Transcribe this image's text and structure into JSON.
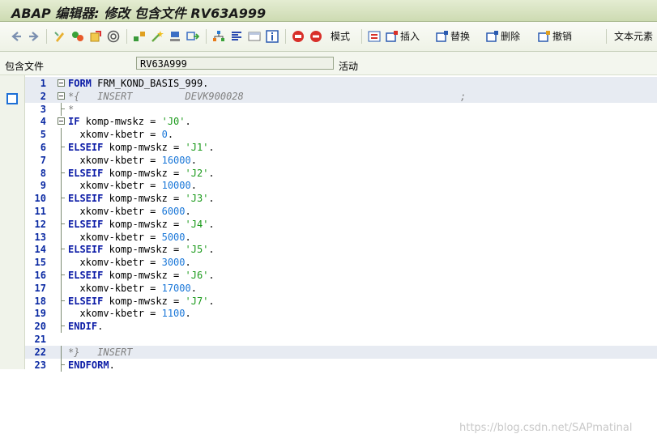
{
  "window": {
    "title": "ABAP 编辑器: 修改 包含文件 RV63A999"
  },
  "toolbar": {
    "icons": [
      "back-arrow-icon",
      "forward-arrow-icon",
      "display-change-icon",
      "other-object-icon",
      "activate-icon",
      "check-icon",
      "where-used-icon",
      "wand-icon",
      "network-icon",
      "window-icon",
      "hierarchy-icon",
      "pretty-printer-icon",
      "layout-icon",
      "info-icon",
      "help-icon",
      "bulletin-icon"
    ],
    "pattern_label": "模式",
    "insert_label": "插入",
    "replace_label": "替换",
    "delete_label": "删除",
    "undo_label": "撤销",
    "text_elements_label": "文本元素"
  },
  "field": {
    "label": "包含文件",
    "value": "RV63A999",
    "status": "活动"
  },
  "editor": {
    "lines": [
      {
        "n": "1",
        "tokens": [
          [
            "kw",
            "FORM"
          ],
          [
            "plain",
            " FRM_KOND_BASIS_999."
          ]
        ],
        "hl": true
      },
      {
        "n": "2",
        "tokens": [
          [
            "cm",
            "*{   INSERT         DEVK900028                                     ;"
          ]
        ],
        "hl": true
      },
      {
        "n": "3",
        "tokens": [
          [
            "cm",
            "*"
          ]
        ],
        "hl": false
      },
      {
        "n": "4",
        "tokens": [
          [
            "kw",
            "IF"
          ],
          [
            "id",
            " komp-mwskz = "
          ],
          [
            "str",
            "'J0'"
          ],
          [
            "id",
            "."
          ]
        ],
        "hl": false
      },
      {
        "n": "5",
        "tokens": [
          [
            "id",
            "  xkomv-kbetr = "
          ],
          [
            "num",
            "0"
          ],
          [
            "id",
            "."
          ]
        ],
        "hl": false
      },
      {
        "n": "6",
        "tokens": [
          [
            "kw",
            "ELSEIF"
          ],
          [
            "id",
            " komp-mwskz = "
          ],
          [
            "str",
            "'J1'"
          ],
          [
            "id",
            "."
          ]
        ],
        "hl": false
      },
      {
        "n": "7",
        "tokens": [
          [
            "id",
            "  xkomv-kbetr = "
          ],
          [
            "num",
            "16000"
          ],
          [
            "id",
            "."
          ]
        ],
        "hl": false
      },
      {
        "n": "8",
        "tokens": [
          [
            "kw",
            "ELSEIF"
          ],
          [
            "id",
            " komp-mwskz = "
          ],
          [
            "str",
            "'J2'"
          ],
          [
            "id",
            "."
          ]
        ],
        "hl": false
      },
      {
        "n": "9",
        "tokens": [
          [
            "id",
            "  xkomv-kbetr = "
          ],
          [
            "num",
            "10000"
          ],
          [
            "id",
            "."
          ]
        ],
        "hl": false
      },
      {
        "n": "10",
        "tokens": [
          [
            "kw",
            "ELSEIF"
          ],
          [
            "id",
            " komp-mwskz = "
          ],
          [
            "str",
            "'J3'"
          ],
          [
            "id",
            "."
          ]
        ],
        "hl": false
      },
      {
        "n": "11",
        "tokens": [
          [
            "id",
            "  xkomv-kbetr = "
          ],
          [
            "num",
            "6000"
          ],
          [
            "id",
            "."
          ]
        ],
        "hl": false
      },
      {
        "n": "12",
        "tokens": [
          [
            "kw",
            "ELSEIF"
          ],
          [
            "id",
            " komp-mwskz = "
          ],
          [
            "str",
            "'J4'"
          ],
          [
            "id",
            "."
          ]
        ],
        "hl": false
      },
      {
        "n": "13",
        "tokens": [
          [
            "id",
            "  xkomv-kbetr = "
          ],
          [
            "num",
            "5000"
          ],
          [
            "id",
            "."
          ]
        ],
        "hl": false
      },
      {
        "n": "14",
        "tokens": [
          [
            "kw",
            "ELSEIF"
          ],
          [
            "id",
            " komp-mwskz = "
          ],
          [
            "str",
            "'J5'"
          ],
          [
            "id",
            "."
          ]
        ],
        "hl": false
      },
      {
        "n": "15",
        "tokens": [
          [
            "id",
            "  xkomv-kbetr = "
          ],
          [
            "num",
            "3000"
          ],
          [
            "id",
            "."
          ]
        ],
        "hl": false
      },
      {
        "n": "16",
        "tokens": [
          [
            "kw",
            "ELSEIF"
          ],
          [
            "id",
            " komp-mwskz = "
          ],
          [
            "str",
            "'J6'"
          ],
          [
            "id",
            "."
          ]
        ],
        "hl": false
      },
      {
        "n": "17",
        "tokens": [
          [
            "id",
            "  xkomv-kbetr = "
          ],
          [
            "num",
            "17000"
          ],
          [
            "id",
            "."
          ]
        ],
        "hl": false
      },
      {
        "n": "18",
        "tokens": [
          [
            "kw",
            "ELSEIF"
          ],
          [
            "id",
            " komp-mwskz = "
          ],
          [
            "str",
            "'J7'"
          ],
          [
            "id",
            "."
          ]
        ],
        "hl": false
      },
      {
        "n": "19",
        "tokens": [
          [
            "id",
            "  xkomv-kbetr = "
          ],
          [
            "num",
            "1100"
          ],
          [
            "id",
            "."
          ]
        ],
        "hl": false
      },
      {
        "n": "20",
        "tokens": [
          [
            "kw",
            "ENDIF"
          ],
          [
            "id",
            "."
          ]
        ],
        "hl": false
      },
      {
        "n": "21",
        "tokens": [],
        "hl": false
      },
      {
        "n": "22",
        "tokens": [
          [
            "cm",
            "*}   INSERT"
          ]
        ],
        "hl": true
      },
      {
        "n": "23",
        "tokens": [
          [
            "kw",
            "ENDFORM"
          ],
          [
            "id",
            "."
          ]
        ],
        "hl": false
      }
    ]
  },
  "watermark": "https://blog.csdn.net/SAPmatinal",
  "colors": {
    "keyword": "#0b1ba6",
    "string": "#1b9a1b",
    "number": "#1a77d8",
    "comment": "#7f7f7f",
    "line_number": "#0b2aa3"
  }
}
